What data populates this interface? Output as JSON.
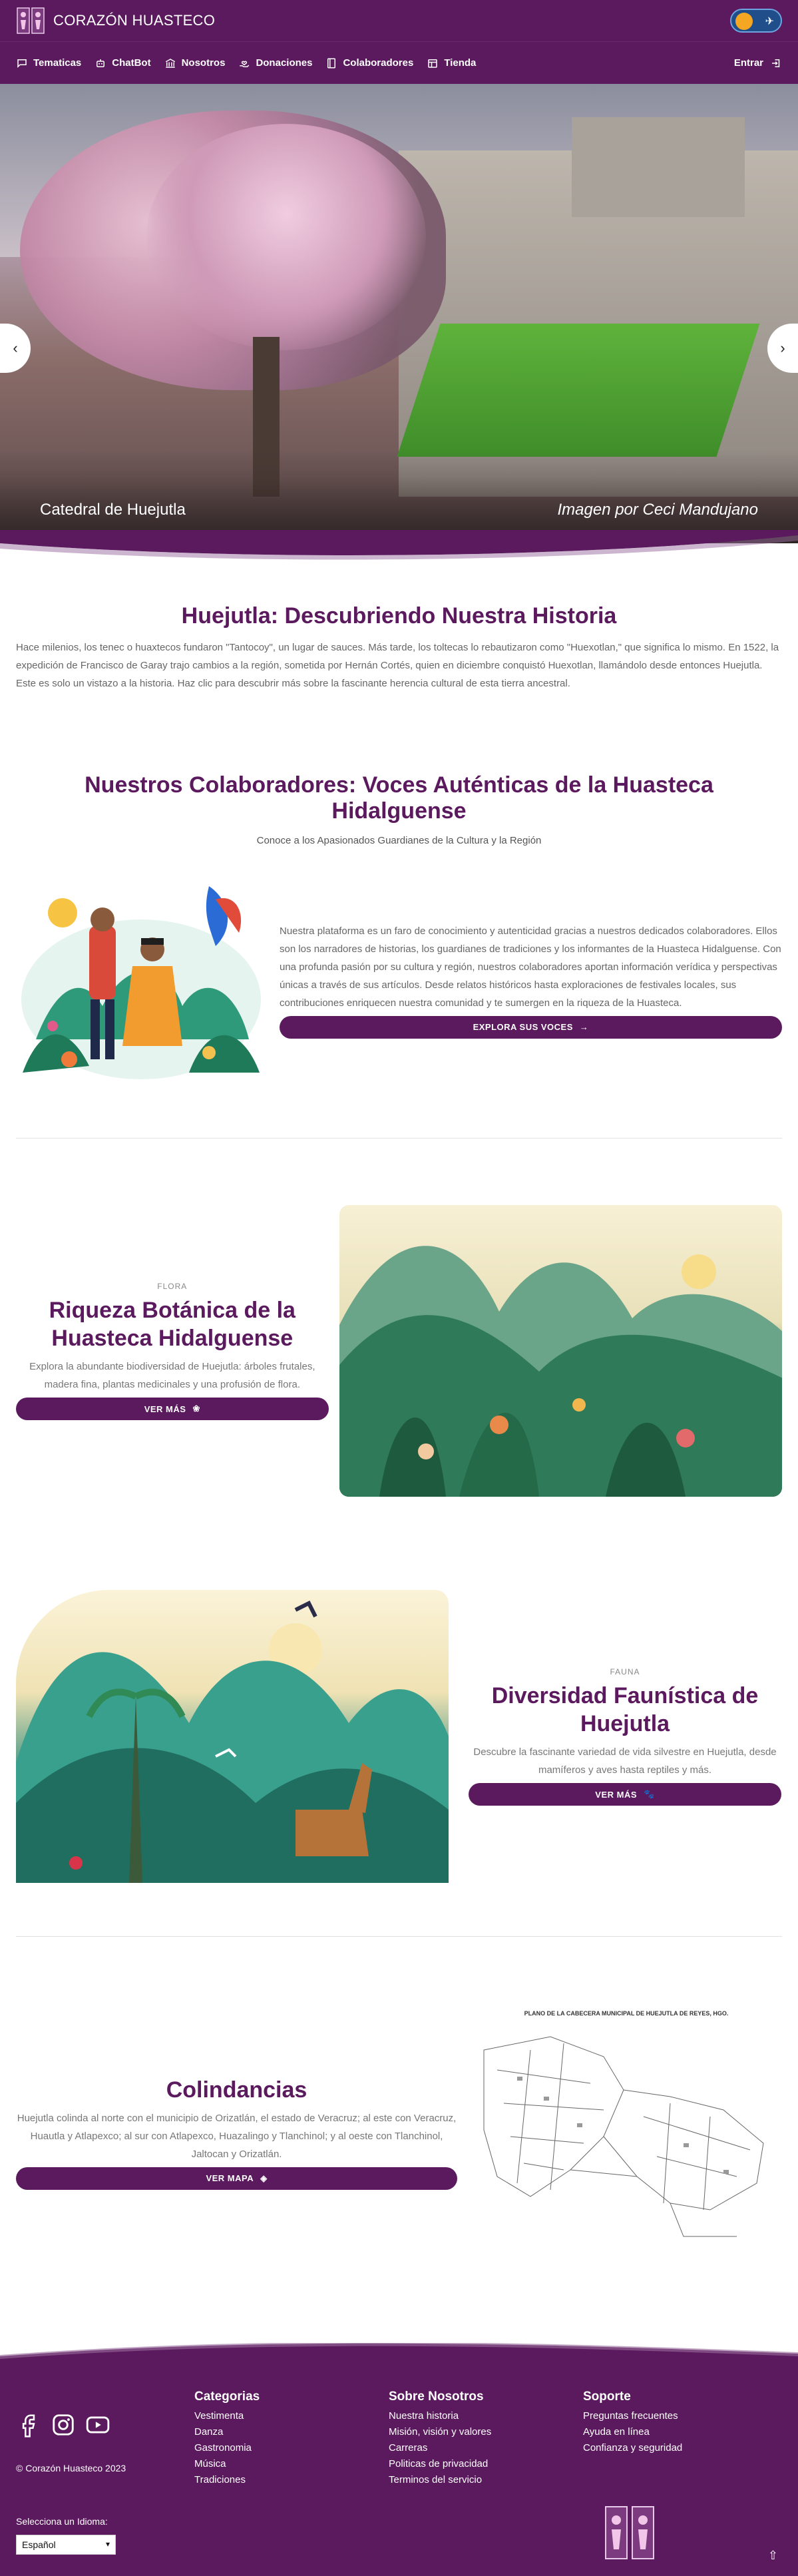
{
  "header": {
    "brand": "CORAZÓN HUASTECO",
    "nav": [
      {
        "label": "Tematicas",
        "icon": "chat-icon"
      },
      {
        "label": "ChatBot",
        "icon": "robot-icon"
      },
      {
        "label": "Nosotros",
        "icon": "building-icon"
      },
      {
        "label": "Donaciones",
        "icon": "hand-heart-icon"
      },
      {
        "label": "Colaboradores",
        "icon": "book-icon"
      },
      {
        "label": "Tienda",
        "icon": "store-icon"
      }
    ],
    "login_label": "Entrar"
  },
  "hero": {
    "caption": "Catedral de Huejutla",
    "credit": "Imagen por Ceci Mandujano"
  },
  "history": {
    "title": "Huejutla: Descubriendo Nuestra Historia",
    "text": "Hace milenios, los tenec o huaxtecos fundaron \"Tantocoy\", un lugar de sauces. Más tarde, los toltecas lo rebautizaron como \"Huexotlan,\" que significa lo mismo. En 1522, la expedición de Francisco de Garay trajo cambios a la región, sometida por Hernán Cortés, quien en diciembre conquistó Huexotlan, llamándolo desde entonces Huejutla. Este es solo un vistazo a la historia. Haz clic para descubrir más sobre la fascinante herencia cultural de esta tierra ancestral."
  },
  "collaborators": {
    "title": "Nuestros Colaboradores: Voces Auténticas de la Huasteca Hidalguense",
    "subtitle": "Conoce a los Apasionados Guardianes de la Cultura y la Región",
    "text": "Nuestra plataforma es un faro de conocimiento y autenticidad gracias a nuestros dedicados colaboradores. Ellos son los narradores de historias, los guardianes de tradiciones y los informantes de la Huasteca Hidalguense. Con una profunda pasión por su cultura y región, nuestros colaboradores aportan información verídica y perspectivas únicas a través de sus artículos. Desde relatos históricos hasta exploraciones de festivales locales, sus contribuciones enriquecen nuestra comunidad y te sumergen en la riqueza de la Huasteca.",
    "button": "EXPLORA SUS VOCES"
  },
  "flora": {
    "kicker": "FLORA",
    "title": "Riqueza Botánica de la Huasteca Hidalguense",
    "desc": "Explora la abundante biodiversidad de Huejutla: árboles frutales, madera fina, plantas medicinales y una profusión de flora.",
    "button": "VER MÁS"
  },
  "fauna": {
    "kicker": "FAUNA",
    "title": "Diversidad Faunística de Huejutla",
    "desc": "Descubre la fascinante variedad de vida silvestre en Huejutla, desde mamíferos y aves hasta reptiles y más.",
    "button": "VER MÁS"
  },
  "limits": {
    "title": "Colindancias",
    "desc": "Huejutla colinda al norte con el municipio de Orizatlán, el estado de Veracruz; al este con Veracruz, Huautla y Atlapexco; al sur con Atlapexco, Huazalingo y Tlanchinol; y al oeste con Tlanchinol, Jaltocan y Orizatlán.",
    "button": "VER MAPA",
    "map_title": "PLANO DE LA CABECERA MUNICIPAL DE HUEJUTLA DE REYES, HGO."
  },
  "footer": {
    "copyright": "© Corazón Huasteco 2023",
    "columns": [
      {
        "title": "Categorias",
        "links": [
          "Vestimenta",
          "Danza",
          "Gastronomia",
          "Música",
          "Tradiciones"
        ]
      },
      {
        "title": "Sobre Nosotros",
        "links": [
          "Nuestra historia",
          "Misión, visión y valores",
          "Carreras",
          "Politicas de privacidad",
          "Terminos del servicio"
        ]
      },
      {
        "title": "Soporte",
        "links": [
          "Preguntas frecuentes",
          "Ayuda en línea",
          "Confianza y seguridad"
        ]
      }
    ],
    "language_label": "Selecciona un Idioma:",
    "language_value": "Español"
  },
  "colors": {
    "brand": "#5b1a5e",
    "accent": "#f5a623",
    "toggle": "#1f4e8a"
  }
}
